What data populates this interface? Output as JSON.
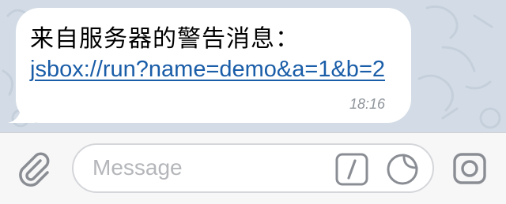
{
  "message": {
    "title": "来自服务器的警告消息：",
    "link": "jsbox://run?name=demo&a=1&b=2",
    "time": "18:16"
  },
  "input": {
    "placeholder": "Message"
  },
  "icons": {
    "attach": "paperclip-icon",
    "commands": "slash-command-icon",
    "sticker": "sticker-icon",
    "camera": "camera-icon"
  },
  "colors": {
    "link": "#1a5da8",
    "time": "#8f959b",
    "wallpaper": "#d3dce6",
    "icon": "#8a8e94"
  }
}
